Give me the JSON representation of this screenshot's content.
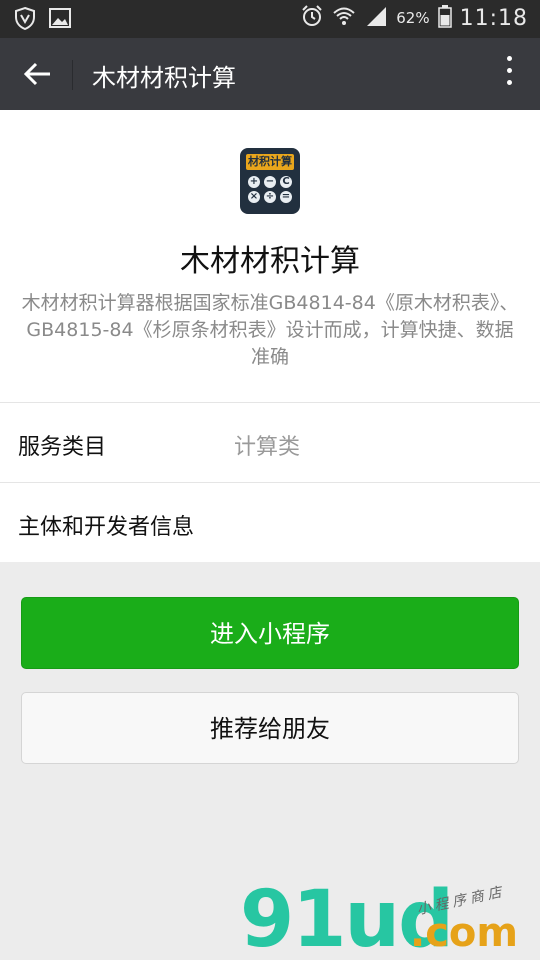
{
  "status_bar": {
    "battery": "62%",
    "time": "11:18",
    "icons": [
      "shield-icon",
      "gallery-icon",
      "alarm-icon",
      "wifi-icon",
      "signal-icon",
      "battery-icon"
    ]
  },
  "app_bar": {
    "title": "木材材积计算",
    "back_icon": "back-arrow-icon",
    "more_icon": "more-vertical-icon"
  },
  "profile": {
    "logo_text": "材积计算",
    "logo_keys": [
      "+",
      "−",
      "C",
      "×",
      "÷",
      "="
    ],
    "name": "木材材积计算",
    "description": "木材材积计算器根据国家标准GB4814-84《原木材积表》、GB4815-84《杉原条材积表》设计而成，计算快捷、数据准确"
  },
  "rows": {
    "category_label": "服务类目",
    "category_value": "计算类",
    "developer_label": "主体和开发者信息"
  },
  "buttons": {
    "enter": "进入小程序",
    "share": "推荐给朋友"
  },
  "watermark": {
    "main": "91ud",
    "suffix": ".com",
    "script": "小程序商店"
  },
  "colors": {
    "status_bar": "#2b2b2b",
    "app_bar": "#393a3f",
    "primary": "#1aad19",
    "logo_bg": "#22303f",
    "logo_accent": "#e9a61c",
    "watermark_green": "#27c6a2",
    "watermark_orange": "#e6a219"
  }
}
